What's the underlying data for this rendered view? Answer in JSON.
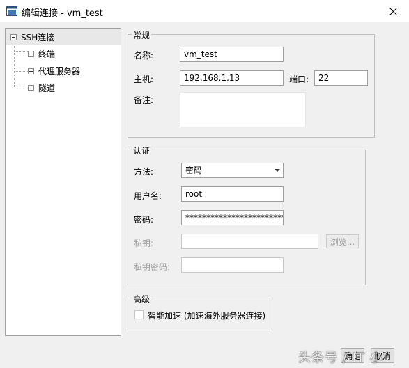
{
  "window": {
    "title": "编辑连接 - vm_test",
    "app_icon": "terminal-window-icon",
    "close_icon": "close-icon"
  },
  "tree": {
    "root": "SSH连接",
    "children": [
      "终端",
      "代理服务器",
      "隧道"
    ]
  },
  "general": {
    "legend": "常规",
    "name_label": "名称:",
    "name_value": "vm_test",
    "host_label": "主机:",
    "host_value": "192.168.1.13",
    "port_label": "端口:",
    "port_value": "22",
    "note_label": "备注:",
    "note_value": ""
  },
  "auth": {
    "legend": "认证",
    "method_label": "方法:",
    "method_value": "密码",
    "user_label": "用户名:",
    "user_value": "root",
    "password_label": "密码:",
    "password_value": "************************",
    "key_label": "私钥:",
    "key_value": "",
    "browse_label": "浏览...",
    "key_password_label": "私钥密码:",
    "key_password_value": ""
  },
  "advanced": {
    "legend": "高级",
    "accelerate_label": "智能加速 (加速海外服务器连接)",
    "accelerate_checked": false
  },
  "footer": {
    "ok_label": "确定",
    "cancel_label": "取消",
    "watermark": "头条号 / IT  小"
  },
  "colors": {
    "window_bg": "#f0f0f0",
    "titlebar_bg": "#ffffff",
    "border": "#a0a0a0",
    "disabled_text": "#a0a0a0",
    "selection_bg": "#e8e8e8"
  }
}
